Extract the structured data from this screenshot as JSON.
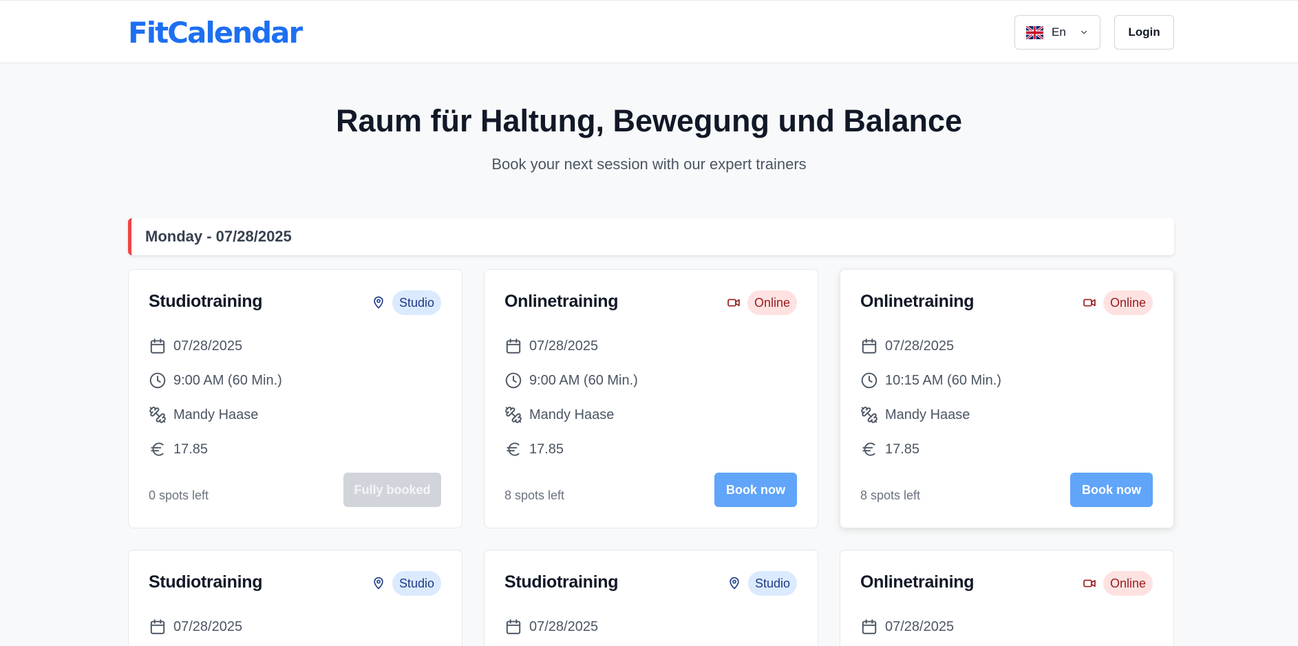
{
  "header": {
    "logo_text": "FitCalendar",
    "language": {
      "label": "En",
      "flag": "uk-flag-icon"
    },
    "login_label": "Login"
  },
  "hero": {
    "title": "Raum für Haltung, Bewegung und Balance",
    "subtitle": "Book your next session with our expert trainers"
  },
  "day": {
    "label": "Monday - 07/28/2025"
  },
  "colors": {
    "brand": "#1d6ff2",
    "accent_bar": "#ef4444",
    "book_button": "#60a5fa",
    "studio_badge_bg": "#dbeafe",
    "online_badge_bg": "#fee2e2"
  },
  "cards": [
    {
      "title": "Studiotraining",
      "type": "Studio",
      "type_icon": "location-pin-icon",
      "date": "07/28/2025",
      "time": "9:00 AM (60 Min.)",
      "trainer": "Mandy Haase",
      "price": "17.85",
      "spots": "0 spots left",
      "action": "Fully booked"
    },
    {
      "title": "Onlinetraining",
      "type": "Online",
      "type_icon": "video-camera-icon",
      "date": "07/28/2025",
      "time": "9:00 AM (60 Min.)",
      "trainer": "Mandy Haase",
      "price": "17.85",
      "spots": "8 spots left",
      "action": "Book now"
    },
    {
      "title": "Onlinetraining",
      "type": "Online",
      "type_icon": "video-camera-icon",
      "date": "07/28/2025",
      "time": "10:15 AM (60 Min.)",
      "trainer": "Mandy Haase",
      "price": "17.85",
      "spots": "8 spots left",
      "action": "Book now"
    },
    {
      "title": "Studiotraining",
      "type": "Studio",
      "type_icon": "location-pin-icon",
      "date": "07/28/2025"
    },
    {
      "title": "Studiotraining",
      "type": "Studio",
      "type_icon": "location-pin-icon",
      "date": "07/28/2025"
    },
    {
      "title": "Onlinetraining",
      "type": "Online",
      "type_icon": "video-camera-icon",
      "date": "07/28/2025"
    }
  ]
}
